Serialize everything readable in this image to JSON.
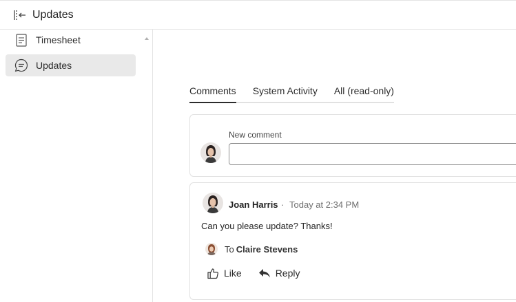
{
  "header": {
    "title": "Updates",
    "collapse_icon": "collapse-panel-icon"
  },
  "sidebar": {
    "items": [
      {
        "label": "Timesheet",
        "icon": "document-icon",
        "active": false
      },
      {
        "label": "Updates",
        "icon": "chat-bubble-icon",
        "active": true
      }
    ]
  },
  "tabs": [
    {
      "label": "Comments",
      "active": true
    },
    {
      "label": "System Activity",
      "active": false
    },
    {
      "label": "All (read-only)",
      "active": false
    }
  ],
  "new_comment": {
    "label": "New comment",
    "value": "",
    "placeholder": ""
  },
  "comment": {
    "author": "Joan Harris",
    "separator": "·",
    "time": "Today at 2:34 PM",
    "body": "Can you please update? Thanks!",
    "to_label": "To",
    "to_name": "Claire Stevens",
    "like_label": "Like",
    "reply_label": "Reply"
  },
  "colors": {
    "active_bg": "#e9e9e9",
    "border": "#e1e1e1",
    "text": "#2c2c2c",
    "muted": "#6e6e6e"
  }
}
